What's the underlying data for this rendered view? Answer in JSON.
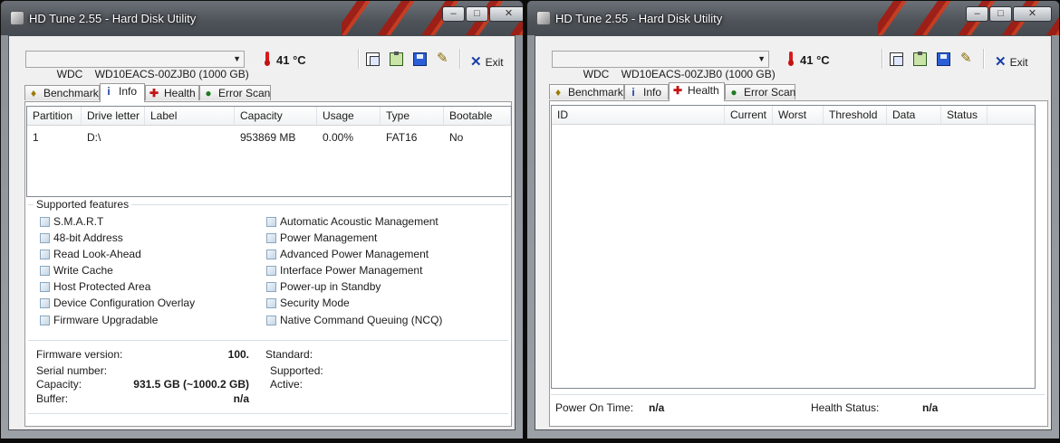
{
  "app": {
    "title": "HD Tune 2.55 - Hard Disk Utility",
    "drive_select": "WDC    WD10EACS-00ZJB0 (1000 GB)",
    "temperature": "41 °C",
    "exit_label": "Exit",
    "window_buttons": {
      "minimize": "–",
      "maximize": "□",
      "close": "✕"
    },
    "toolbar_icons": [
      "copy-icon",
      "paste-icon",
      "save-icon",
      "options-icon"
    ]
  },
  "tabs": [
    {
      "label": "Benchmark",
      "icon": "benchmark-icon"
    },
    {
      "label": "Info",
      "icon": "info-icon"
    },
    {
      "label": "Health",
      "icon": "health-icon"
    },
    {
      "label": "Error Scan",
      "icon": "error-scan-icon"
    }
  ],
  "info": {
    "partition_columns": [
      "Partition",
      "Drive letter",
      "Label",
      "Capacity",
      "Usage",
      "Type",
      "Bootable"
    ],
    "partition_rows": [
      [
        "1",
        "D:\\",
        "",
        "953869 MB",
        "0.00%",
        "FAT16",
        "No"
      ]
    ],
    "features_title": "Supported features",
    "features_left": [
      "S.M.A.R.T",
      "48-bit Address",
      "Read Look-Ahead",
      "Write Cache",
      "Host Protected Area",
      "Device Configuration Overlay",
      "Firmware Upgradable"
    ],
    "features_right": [
      "Automatic Acoustic Management",
      "Power Management",
      "Advanced Power Management",
      "Interface Power Management",
      "Power-up in Standby",
      "Security Mode",
      "Native Command Queuing (NCQ)"
    ],
    "details": {
      "firmware_label": "Firmware version:",
      "firmware_value": "100.",
      "serial_label": "Serial number:",
      "serial_value": "",
      "capacity_label": "Capacity:",
      "capacity_value": "931.5 GB (~1000.2 GB)",
      "buffer_label": "Buffer:",
      "buffer_value": "n/a",
      "standard_label": "Standard:",
      "supported_label": "Supported:",
      "active_label": "Active:"
    }
  },
  "health": {
    "columns": [
      "ID",
      "Current",
      "Worst",
      "Threshold",
      "Data",
      "Status"
    ],
    "power_on_label": "Power On Time:",
    "power_on_value": "n/a",
    "status_label": "Health Status:",
    "status_value": "n/a"
  }
}
